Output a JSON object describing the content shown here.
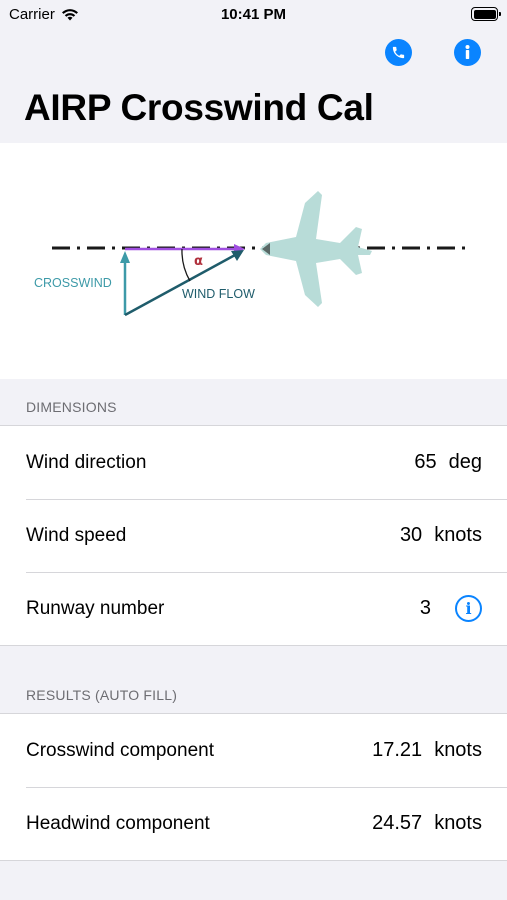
{
  "status_bar": {
    "carrier": "Carrier",
    "time": "10:41 PM"
  },
  "nav": {
    "icons": [
      "phone-icon",
      "info-icon"
    ]
  },
  "title": "AIRP Crosswind Cal",
  "diagram": {
    "crosswind_label": "CROSSWIND",
    "wind_flow_label": "WIND FLOW",
    "angle_label": "α"
  },
  "dimensions": {
    "header": "DIMENSIONS",
    "rows": [
      {
        "label": "Wind direction",
        "value": "65",
        "unit": "deg"
      },
      {
        "label": "Wind speed",
        "value": "30",
        "unit": "knots"
      },
      {
        "label": "Runway number",
        "value": "3"
      }
    ]
  },
  "results": {
    "header": "RESULTS (AUTO FILL)",
    "rows": [
      {
        "label": "Crosswind component",
        "value": "17.21",
        "unit": "knots"
      },
      {
        "label": "Headwind component",
        "value": "24.57",
        "unit": "knots"
      }
    ]
  },
  "colors": {
    "accent": "#0a84ff",
    "crosswind": "#3d9aa8",
    "windflow": "#1f5c6b",
    "runway_arrow": "#a04fe0",
    "angle": "#b0303c"
  }
}
